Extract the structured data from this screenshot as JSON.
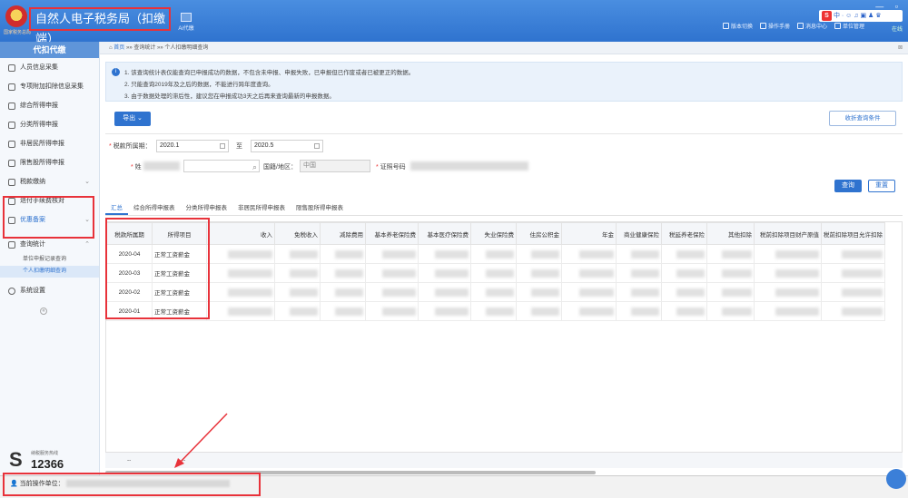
{
  "app": {
    "title": "自然人电子税务局（扣缴端）",
    "logo_sub": "国家税务总局",
    "proxy_tab_label": "Ai代缴",
    "window_controls": "— ▫",
    "ime": "中 · ☺ ♫ ▣ ♟ ♛",
    "online": "在线"
  },
  "top_actions": [
    {
      "label": "版本切换",
      "icon": "swap-icon"
    },
    {
      "label": "操作手册",
      "icon": "book-icon"
    },
    {
      "label": "消息中心",
      "icon": "mail-icon"
    },
    {
      "label": "单位管理",
      "icon": "building-icon"
    }
  ],
  "sidebar": {
    "header": "代扣代缴",
    "items": [
      {
        "label": "人员信息采集",
        "icon": "person-icon",
        "chevron": ""
      },
      {
        "label": "专项附加扣除信息采集",
        "icon": "grid-icon",
        "chevron": ""
      },
      {
        "label": "综合所得申报",
        "icon": "layers-icon",
        "chevron": ""
      },
      {
        "label": "分类所得申报",
        "icon": "clock-icon",
        "chevron": ""
      },
      {
        "label": "非居民所得申报",
        "icon": "person-plus-icon",
        "chevron": ""
      },
      {
        "label": "限售股所得申报",
        "icon": "bar-chart-icon",
        "chevron": ""
      },
      {
        "label": "税款缴纳",
        "icon": "wallet-icon",
        "chevron": "⌄"
      },
      {
        "label": "退付手续费核对",
        "icon": "money-icon",
        "chevron": ""
      },
      {
        "label": "优惠备案",
        "icon": "document-icon",
        "chevron": "⌄"
      }
    ],
    "query_group": {
      "label": "查询统计",
      "icon": "search-icon",
      "chevron": "⌃",
      "sub_items": [
        "单位申报记录查询",
        "个人扣缴明细查询"
      ]
    },
    "settings": "系统设置",
    "hotline_label": "纳税服务热线",
    "hotline_number": "12366"
  },
  "breadcrumb": {
    "home": "首页",
    "sep1": "»»",
    "level1": "查询统计",
    "sep2": "»»",
    "level2": "个人扣缴明细查询",
    "close": "⊠"
  },
  "notice": [
    "1. 该查询统计表仅能查询已申报成功的数据，不包含未申报、申报失败，已申报但已作废或者已被更正的数据。",
    "2. 只能查询2019年及之后的数据，不能进行跨年度查询。",
    "3. 由于数据处理的滞后性，建议您在申报成功3天之后再来查询最新的申报数据。"
  ],
  "toolbar": {
    "export": "导出 ⌄",
    "collapse": "收折查询条件"
  },
  "form": {
    "period_label": "税款所属期：",
    "period_from": "2020.1",
    "to_label": "至",
    "period_to": "2020.5",
    "name_label": "姓",
    "nationality_label": "国籍/地区：",
    "nationality_value": "中国",
    "id_label": "证照号码",
    "query_btn": "查询",
    "reset_btn": "重置"
  },
  "tabs": [
    "汇总",
    "综合所得申报表",
    "分类所得申报表",
    "非居民所得申报表",
    "限售股所得申报表"
  ],
  "table": {
    "columns": [
      "税款所属期",
      "所得项目",
      "收入",
      "免税收入",
      "减除费用",
      "基本养老保险费",
      "基本医疗保险费",
      "失业保险费",
      "住房公积金",
      "年金",
      "商业健康保险",
      "税延养老保险",
      "其他扣除",
      "税前扣除项目财产原值",
      "税前扣除项目允许扣除"
    ],
    "rows": [
      {
        "period": "2020-04",
        "item": "正常工资薪金"
      },
      {
        "period": "2020-03",
        "item": "正常工资薪金"
      },
      {
        "period": "2020-02",
        "item": "正常工资薪金"
      },
      {
        "period": "2020-01",
        "item": "正常工资薪金"
      }
    ],
    "summary_period": "--",
    "summary_item": "--"
  },
  "status": {
    "current_unit_label": "当前操作单位："
  }
}
